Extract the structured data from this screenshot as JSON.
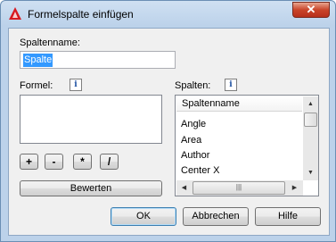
{
  "window": {
    "title": "Formelspalte einfügen",
    "close_glyph": "✕",
    "app_icon": "autocad-logo-icon"
  },
  "spaltenname": {
    "label": "Spaltenname:",
    "value": "Spalte"
  },
  "formel": {
    "label": "Formel:",
    "info_glyph": "i",
    "value": ""
  },
  "operators": [
    "+",
    "-",
    "*",
    "/"
  ],
  "bewerten_label": "Bewerten",
  "spalten": {
    "label": "Spalten:",
    "info_glyph": "i",
    "header": "Spaltenname",
    "items": [
      "Angle",
      "Area",
      "Author",
      "Center X"
    ],
    "scroll_grip": "|||"
  },
  "buttons": {
    "ok": "OK",
    "cancel": "Abbrechen",
    "help": "Hilfe"
  }
}
